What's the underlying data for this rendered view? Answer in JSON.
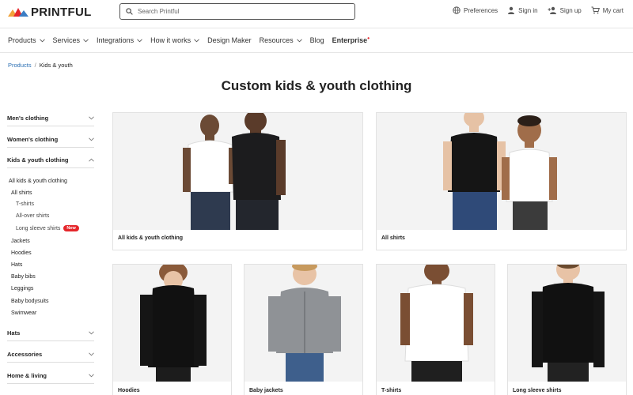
{
  "header": {
    "logo_text": "PRINTFUL",
    "search_placeholder": "Search Printful",
    "links": {
      "preferences": "Preferences",
      "sign_in": "Sign in",
      "sign_up": "Sign up",
      "cart": "My cart"
    }
  },
  "nav": {
    "items": [
      {
        "label": "Products",
        "dropdown": true
      },
      {
        "label": "Services",
        "dropdown": true
      },
      {
        "label": "Integrations",
        "dropdown": true
      },
      {
        "label": "How it works",
        "dropdown": true
      },
      {
        "label": "Design Maker",
        "dropdown": false
      },
      {
        "label": "Resources",
        "dropdown": true
      },
      {
        "label": "Blog",
        "dropdown": false
      },
      {
        "label": "Enterprise",
        "dropdown": false
      }
    ],
    "enterprise_marker": "•"
  },
  "breadcrumb": {
    "root": "Products",
    "separator": "/",
    "current": "Kids & youth"
  },
  "page_title": "Custom kids & youth clothing",
  "sidebar": {
    "categories": {
      "mens": "Men's clothing",
      "womens": "Women's clothing",
      "kids": "Kids & youth clothing",
      "hats": "Hats",
      "accessories": "Accessories",
      "home": "Home & living"
    },
    "kids_sub": {
      "all_kids": "All kids & youth clothing",
      "all_shirts": "All shirts",
      "tshirts": "T-shirts",
      "allover": "All-over shirts",
      "long_sleeve": "Long sleeve shirts",
      "new_badge": "New",
      "jackets": "Jackets",
      "hoodies": "Hoodies",
      "hats": "Hats",
      "baby_bibs": "Baby bibs",
      "leggings": "Leggings",
      "baby_bodysuits": "Baby bodysuits",
      "swimwear": "Swimwear"
    }
  },
  "cards": {
    "all_kids": "All kids & youth clothing",
    "all_shirts": "All shirts",
    "hoodies": "Hoodies",
    "baby_jackets": "Baby jackets",
    "tshirts": "T-shirts",
    "long_sleeve": "Long sleeve shirts"
  },
  "colors": {
    "accent_red": "#e5262b",
    "link_blue": "#2b6fb3",
    "logo_orange": "#f2a33a",
    "logo_red": "#e5262b",
    "logo_blue": "#3b7dc4"
  }
}
